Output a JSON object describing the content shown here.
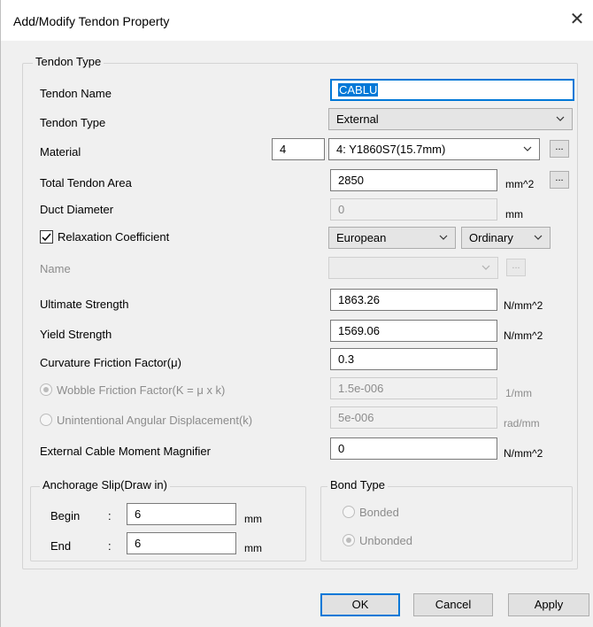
{
  "window": {
    "title": "Add/Modify Tendon Property",
    "close_glyph": "✕"
  },
  "tendon_type_group": {
    "legend": "Tendon Type"
  },
  "tendon_name": {
    "label": "Tendon Name",
    "value": "CABLU"
  },
  "tendon_type": {
    "label": "Tendon Type",
    "selected": "External"
  },
  "material": {
    "label": "Material",
    "number": "4",
    "selected": "4: Y1860S7(15.7mm)",
    "browse": "..."
  },
  "total_area": {
    "label": "Total Tendon Area",
    "value": "2850",
    "unit": "mm^2",
    "browse": "..."
  },
  "duct_diameter": {
    "label": "Duct Diameter",
    "value": "0",
    "unit": "mm"
  },
  "relaxation": {
    "label": "Relaxation Coefficient",
    "checked": true,
    "code": "European",
    "class": "Ordinary"
  },
  "name_row": {
    "label": "Name",
    "selected": "",
    "browse": "..."
  },
  "ultimate_strength": {
    "label": "Ultimate Strength",
    "value": "1863.26",
    "unit": "N/mm^2"
  },
  "yield_strength": {
    "label": "Yield Strength",
    "value": "1569.06",
    "unit": "N/mm^2"
  },
  "curvature_friction": {
    "label": "Curvature Friction Factor(μ)",
    "value": "0.3"
  },
  "wobble_friction": {
    "label": "Wobble Friction Factor(K = μ x k)",
    "value": "1.5e-006",
    "unit": "1/mm",
    "selected": true
  },
  "angular_displacement": {
    "label": "Unintentional Angular Displacement(k)",
    "value": "5e-006",
    "unit": "rad/mm",
    "selected": false
  },
  "moment_magnifier": {
    "label": "External Cable Moment Magnifier",
    "value": "0",
    "unit": "N/mm^2"
  },
  "anchorage": {
    "legend": "Anchorage Slip(Draw in)",
    "begin_label": "Begin",
    "begin_value": "6",
    "end_label": "End",
    "end_value": "6",
    "colon": ":",
    "unit": "mm"
  },
  "bond_type": {
    "legend": "Bond Type",
    "bonded_label": "Bonded",
    "unbonded_label": "Unbonded",
    "selected": "Unbonded"
  },
  "buttons": {
    "ok": "OK",
    "cancel": "Cancel",
    "apply": "Apply"
  },
  "colors": {
    "accent": "#0078d7",
    "disabled_text": "#8c8c8c",
    "face": "#f0f0f0"
  }
}
